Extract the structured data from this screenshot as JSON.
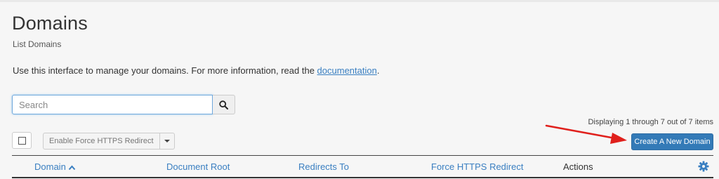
{
  "page": {
    "title": "Domains",
    "subtitle": "List Domains",
    "intro_text": "Use this interface to manage your domains. For more information, read the ",
    "intro_link": "documentation",
    "intro_suffix": "."
  },
  "search": {
    "placeholder": "Search",
    "button_icon": "search-icon"
  },
  "pagination": {
    "display_text": "Displaying 1 through 7 out of 7 items"
  },
  "toolbar": {
    "bulk_action_label": "Enable Force HTTPS Redirect",
    "create_label": "Create A New Domain"
  },
  "table": {
    "columns": [
      {
        "label": "Domain",
        "sortable": true,
        "sort": "ascending"
      },
      {
        "label": "Document Root",
        "sortable": true
      },
      {
        "label": "Redirects To",
        "sortable": true
      },
      {
        "label": "Force HTTPS Redirect",
        "sortable": true
      },
      {
        "label": "Actions",
        "sortable": false
      }
    ],
    "settings_icon": "gear-icon"
  },
  "colors": {
    "accent": "#337ab7",
    "link": "#3a7fc1",
    "annotation_arrow": "#e0201c"
  }
}
